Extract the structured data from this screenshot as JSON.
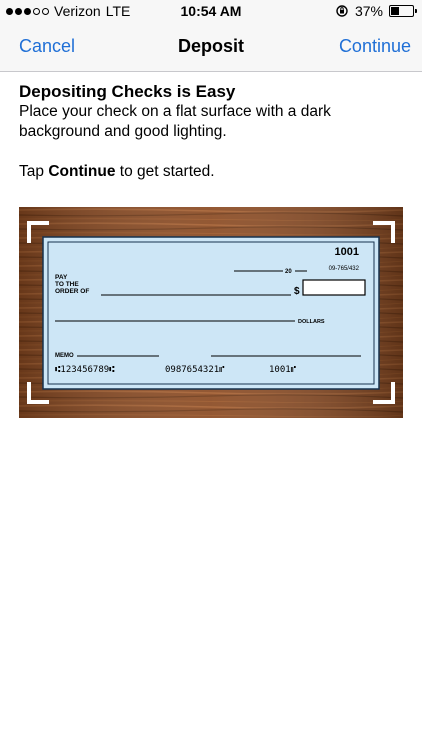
{
  "status": {
    "carrier": "Verizon",
    "network": "LTE",
    "time": "10:54 AM",
    "battery_pct": "37%",
    "battery_level": 0.37
  },
  "nav": {
    "cancel": "Cancel",
    "title": "Deposit",
    "continue": "Continue"
  },
  "content": {
    "heading": "Depositing Checks is Easy",
    "paragraph": "Place your check on a flat surface with a dark background and good lighting.",
    "tap_prefix": "Tap ",
    "tap_bold": "Continue",
    "tap_suffix": " to get started."
  },
  "check": {
    "number": "1001",
    "routing_fraction": "09-765/432",
    "date_prefix": "20",
    "pay_line1": "PAY",
    "pay_line2": "TO THE",
    "pay_line3": "ORDER OF",
    "dollar_sign": "$",
    "dollars": "DOLLARS",
    "memo": "MEMO",
    "micr_routing": "⑆123456789⑆",
    "micr_account": "0987654321⑈",
    "micr_check": "1001⑈"
  },
  "colors": {
    "ios_blue": "#1f6fd6",
    "check_blue": "#cde6f6",
    "wood": "#8a4a22"
  }
}
